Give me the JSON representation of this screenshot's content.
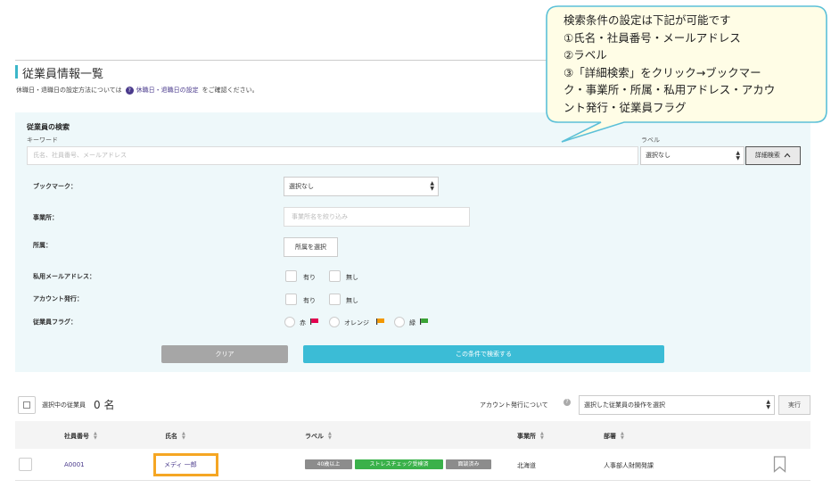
{
  "page": {
    "title": "従業員情報一覧",
    "note_prefix": "休職日・退職日の設定方法については",
    "note_link": "休職日・退職日の設定",
    "note_suffix": "をご確認ください。"
  },
  "search": {
    "panel_title": "従業員の検索",
    "keyword_label": "キーワード",
    "keyword_placeholder": "氏名、社員番号、メールアドレス",
    "label_label": "ラベル",
    "label_select_value": "選択なし",
    "detail_button": "詳細検索",
    "bookmark_label": "ブックマーク：",
    "bookmark_value": "選択なし",
    "office_label": "事業所：",
    "office_placeholder": "事業所名を絞り込み",
    "dept_label": "所属：",
    "dept_button": "所属を選択",
    "private_email_label": "私用メールアドレス：",
    "account_label": "アカウント発行：",
    "yes": "有り",
    "no": "無し",
    "flag_label": "従業員フラグ：",
    "flags": [
      {
        "label": "赤",
        "color": "#e3004f"
      },
      {
        "label": "オレンジ",
        "color": "#f39800"
      },
      {
        "label": "緑",
        "color": "#3aa335"
      }
    ],
    "clear_button": "クリア",
    "submit_button": "この条件で検索する"
  },
  "results": {
    "selected_label": "選択中の従業員",
    "selected_count": "0 名",
    "account_about": "アカウント発行について",
    "operation_select": "選択した従業員の操作を選択",
    "run_button": "実行"
  },
  "table": {
    "headers": [
      "社員番号",
      "氏名",
      "ラベル",
      "事業所",
      "部署"
    ],
    "rows": [
      {
        "employee_id": "A0001",
        "name": "メディ 一郎",
        "labels": [
          {
            "text": "40歳以上",
            "color": "#8c8c8c"
          },
          {
            "text": "ストレスチェック受検済",
            "color": "#3ab14a"
          },
          {
            "text": "面談済み",
            "color": "#8c8c8c"
          }
        ],
        "office": "北海道",
        "department": "人事部人財開発課"
      }
    ]
  },
  "callout": {
    "lines": [
      "検索条件の設定は下記が可能です",
      "①氏名・社員番号・メールアドレス",
      "②ラベル",
      "③「詳細検索」をクリック→ブックマー",
      "ク・事業所・所属・私用アドレス・アカウ",
      "ント発行・従業員フラグ"
    ]
  },
  "colors": {
    "accent": "#3bbcd6",
    "panel_bg": "#eef8fa",
    "link": "#4a3a8c",
    "highlight": "#f5a623",
    "callout_bg": "#fffde6",
    "callout_border": "#5bc0d8"
  }
}
